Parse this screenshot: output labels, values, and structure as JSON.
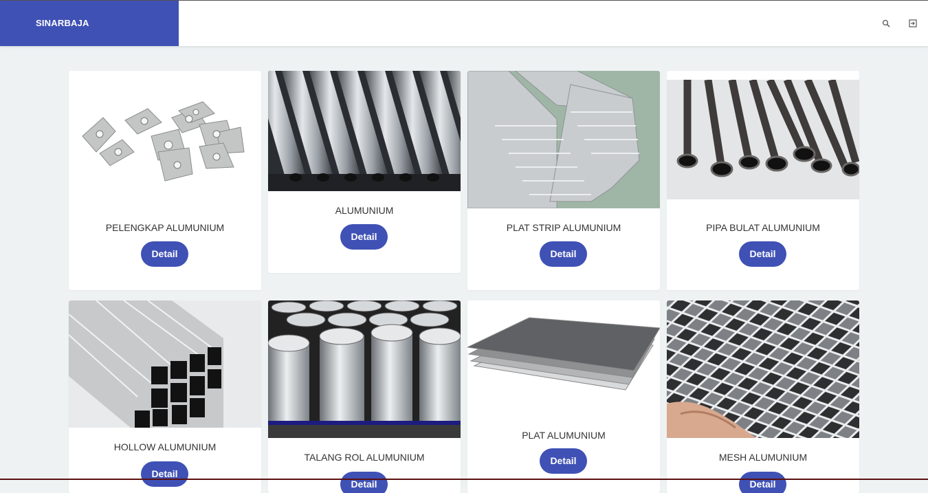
{
  "header": {
    "brand": "SINARBAJA",
    "search_icon": "search-icon",
    "logout_icon": "logout-icon"
  },
  "colors": {
    "primary": "#3f51b5",
    "background": "#eef2f3"
  },
  "products": [
    {
      "title": "PELENGKAP ALUMUNIUM",
      "button": "Detail"
    },
    {
      "title": "ALUMUNIUM",
      "button": "Detail"
    },
    {
      "title": "PLAT STRIP ALUMUNIUM",
      "button": "Detail"
    },
    {
      "title": "PIPA BULAT ALUMUNIUM",
      "button": "Detail"
    },
    {
      "title": "HOLLOW ALUMUNIUM",
      "button": "Detail"
    },
    {
      "title": "TALANG ROL ALUMUNIUM",
      "button": "Detail"
    },
    {
      "title": "PLAT ALUMUNIUM",
      "button": "Detail"
    },
    {
      "title": "MESH ALUMUNIUM",
      "button": "Detail"
    }
  ]
}
